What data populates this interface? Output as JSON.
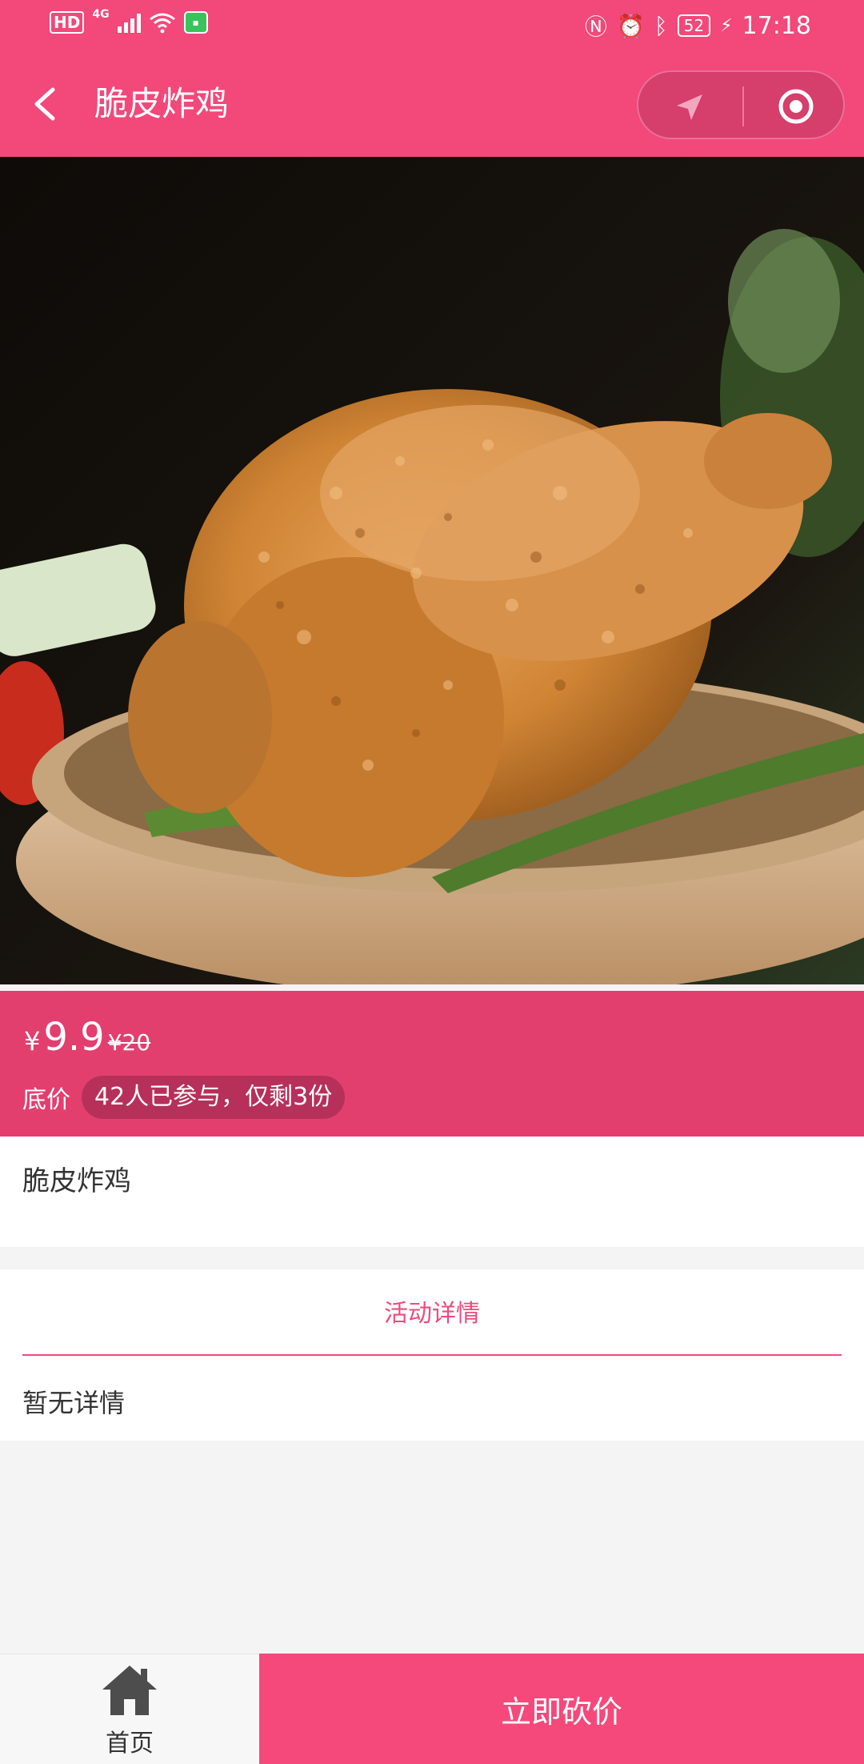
{
  "status_bar": {
    "hd": "HD",
    "network": "4G",
    "battery": "52",
    "time": "17:18"
  },
  "navbar": {
    "title": "脆皮炸鸡"
  },
  "product": {
    "image_subject": "crispy fried chicken in a wooden bowl",
    "currency_symbol": "¥",
    "current_price": "9.9",
    "original_price": "¥20",
    "floor_label": "底价",
    "participation": "42人已参与，仅剩3份",
    "name": "脆皮炸鸡"
  },
  "details": {
    "tab_label": "活动详情",
    "empty_text": "暂无详情"
  },
  "bottom_bar": {
    "home_label": "首页",
    "bargain_label": "立即砍价"
  },
  "colors": {
    "brand_pink": "#f2487a",
    "price_band": "#e23f6f",
    "accent_text": "#ec4c7c"
  }
}
